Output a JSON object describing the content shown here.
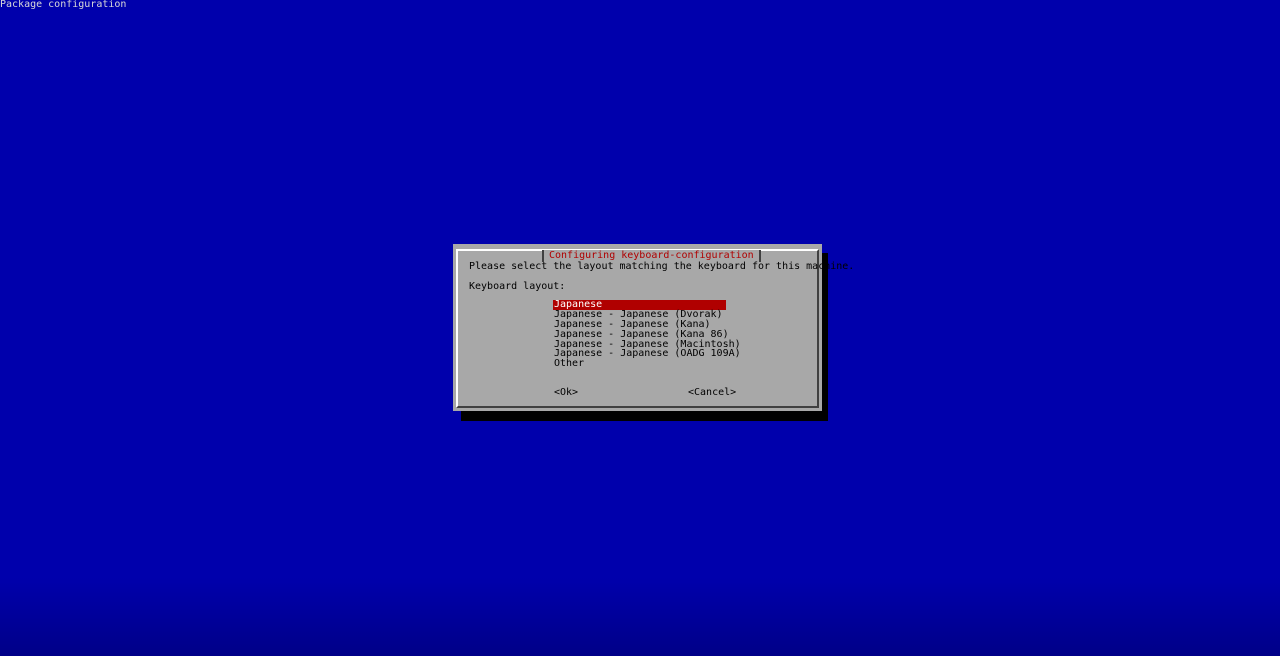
{
  "backtitle": "Package configuration",
  "dialog": {
    "title": "Configuring keyboard-configuration",
    "prompt": "Please select the layout matching the keyboard for this machine.",
    "label": "Keyboard layout:",
    "items": [
      {
        "label": "Japanese",
        "selected": true
      },
      {
        "label": "Japanese - Japanese (Dvorak)",
        "selected": false
      },
      {
        "label": "Japanese - Japanese (Kana)",
        "selected": false
      },
      {
        "label": "Japanese - Japanese (Kana 86)",
        "selected": false
      },
      {
        "label": "Japanese - Japanese (Macintosh)",
        "selected": false
      },
      {
        "label": "Japanese - Japanese (OADG 109A)",
        "selected": false
      },
      {
        "label": "Other",
        "selected": false
      }
    ],
    "ok_label": "<Ok>",
    "cancel_label": "<Cancel>"
  },
  "colors": {
    "background": "#0000ac",
    "dialog": "#a8a8a8",
    "title_text": "#b00000",
    "selection": "#b00000"
  }
}
